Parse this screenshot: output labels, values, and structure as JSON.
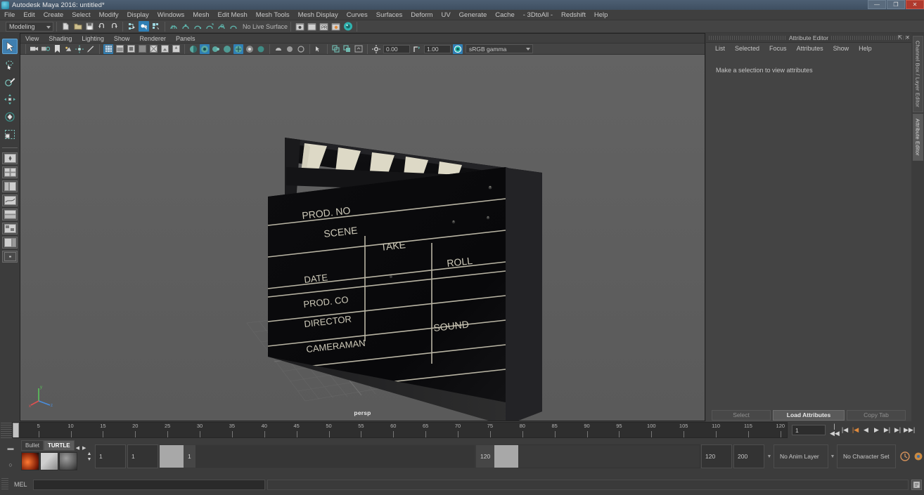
{
  "window": {
    "title": "Autodesk Maya 2016: untitled*",
    "app_icon": "maya-icon",
    "controls": {
      "minimize": "—",
      "maximize": "❐",
      "close": "✕"
    }
  },
  "menubar": {
    "items": [
      "File",
      "Edit",
      "Create",
      "Select",
      "Modify",
      "Display",
      "Windows",
      "Mesh",
      "Edit Mesh",
      "Mesh Tools",
      "Mesh Display",
      "Curves",
      "Surfaces",
      "Deform",
      "UV",
      "Generate",
      "Cache",
      "- 3DtoAll -",
      "Redshift",
      "Help"
    ]
  },
  "statusbar": {
    "menu_set": "Modeling",
    "no_live_surface": "No Live Surface",
    "file_icons": [
      "new-scene-icon",
      "open-scene-icon",
      "save-scene-icon",
      "undo-icon",
      "redo-icon"
    ],
    "select_mask_icons": [
      "select-hierarchy-icon",
      "select-object-icon",
      "select-component-icon"
    ],
    "snap_icons": [
      "snap-to-grid-icon",
      "snap-to-curve-icon",
      "snap-to-point-icon",
      "snap-to-projected-icon",
      "snap-to-view-plane-icon",
      "make-live-icon"
    ],
    "render_icons": [
      "render-current-frame-icon",
      "ipr-render-icon",
      "render-settings-icon",
      "hypershade-icon",
      "render-view-icon"
    ]
  },
  "toolbox": {
    "tools": [
      {
        "name": "select-tool",
        "glyph": "arrow",
        "active": true
      },
      {
        "name": "lasso-select-tool",
        "glyph": "lasso",
        "active": false
      },
      {
        "name": "paint-select-tool",
        "glyph": "brush",
        "active": false
      },
      {
        "name": "move-tool",
        "glyph": "move",
        "active": false
      },
      {
        "name": "rotate-tool",
        "glyph": "rotate",
        "active": false
      },
      {
        "name": "scale-tool",
        "glyph": "scale",
        "active": false
      },
      {
        "name": "last-tool-used",
        "glyph": "square",
        "active": false
      }
    ],
    "layout_presets": [
      "single-perspective-view",
      "four-view",
      "persp-outliner",
      "persp-graph-editor",
      "two-stacked-panes",
      "persp-hypershade",
      "persp-side-panel",
      "persp-blank"
    ]
  },
  "viewport": {
    "menu": [
      "View",
      "Shading",
      "Lighting",
      "Show",
      "Renderer",
      "Panels"
    ],
    "camera_label": "persp",
    "exposure_value": "0.00",
    "gamma_value": "1.00",
    "color_management": "sRGB gamma",
    "left_icons": [
      "select-camera-icon",
      "camera-attributes-icon",
      "bookmark-icon",
      "image-plane-icon",
      "2d-pan-zoom-icon",
      "grease-pencil-icon"
    ],
    "shading_icons": [
      "wireframe-icon",
      "smooth-shade-all-icon",
      "smooth-shade-selected-icon",
      "flat-shade-icon",
      "shaded-wireframe-icon",
      "textured-icon",
      "use-lights-icon"
    ],
    "light_icons": [
      "shadows-icon",
      "screen-space-ao-icon",
      "motion-blur-icon",
      "multisample-icon",
      "depth-of-field-icon",
      "isolate-select-icon",
      "xray-icon",
      "xray-joints-icon",
      "xray-active-components-icon"
    ],
    "panel_icons": [
      "exposure-icon",
      "gamma-icon",
      "color-management-icon"
    ]
  },
  "scene": {
    "object": "clapperboard",
    "labels": {
      "prod_no": "PROD. NO",
      "scene": "SCENE",
      "take": "TAKE",
      "roll": "ROLL",
      "date": "DATE",
      "prod_co": "PROD. CO",
      "director": "DIRECTOR",
      "sound": "SOUND",
      "cameraman": "CAMERAMAN"
    },
    "colors": {
      "board_black": "#08080a",
      "stripe_cream": "#ddd9c6",
      "background": "#5e5e5e",
      "grid_line": "#6e6e6e"
    },
    "axis": {
      "x": "x",
      "y": "y",
      "z": "z"
    }
  },
  "attribute_editor": {
    "title": "Attribute Editor",
    "menu": [
      "List",
      "Selected",
      "Focus",
      "Attributes",
      "Show",
      "Help"
    ],
    "message": "Make a selection to view attributes",
    "buttons": {
      "select": "Select",
      "load_attributes": "Load Attributes",
      "copy_tab": "Copy Tab"
    },
    "window_buttons": {
      "undock": "⇱",
      "close": "✕"
    }
  },
  "side_tabs": [
    {
      "label": "Channel Box / Layer Editor",
      "active": false
    },
    {
      "label": "Attribute Editor",
      "active": true
    }
  ],
  "timeline": {
    "ticks": [
      5,
      10,
      15,
      20,
      25,
      30,
      35,
      40,
      45,
      50,
      55,
      60,
      65,
      70,
      75,
      80,
      85,
      90,
      95,
      100,
      105,
      110,
      115,
      120
    ],
    "start": 1,
    "end": 120,
    "current_frame": "1",
    "cursor_label": "1",
    "transport": [
      {
        "name": "go-to-start-button",
        "glyph": "|◀◀"
      },
      {
        "name": "step-back-key-button",
        "glyph": "|◀"
      },
      {
        "name": "step-back-frame-button",
        "glyph": "|◀"
      },
      {
        "name": "play-backwards-button",
        "glyph": "◀"
      },
      {
        "name": "play-forwards-button",
        "glyph": "▶"
      },
      {
        "name": "step-forward-frame-button",
        "glyph": "▶|"
      },
      {
        "name": "step-forward-key-button",
        "glyph": "▶|"
      },
      {
        "name": "go-to-end-button",
        "glyph": "▶▶|"
      }
    ]
  },
  "range_slider": {
    "shelf_tabs": [
      {
        "label": "Bullet",
        "active": false
      },
      {
        "label": "TURTLE",
        "active": true
      }
    ],
    "anim_start": "1",
    "anim_end": "1",
    "range_start": "1",
    "range_end": "120",
    "playback_start": "120",
    "playback_end": "200",
    "anim_layer": "No Anim Layer",
    "character_set": "No Character Set",
    "auto_keyframe_icon": "auto-keyframe-icon",
    "animation_prefs_icon": "animation-preferences-icon"
  },
  "command_line": {
    "language": "MEL",
    "input_value": "",
    "output_value": "",
    "script_editor_icon": "script-editor-icon"
  }
}
